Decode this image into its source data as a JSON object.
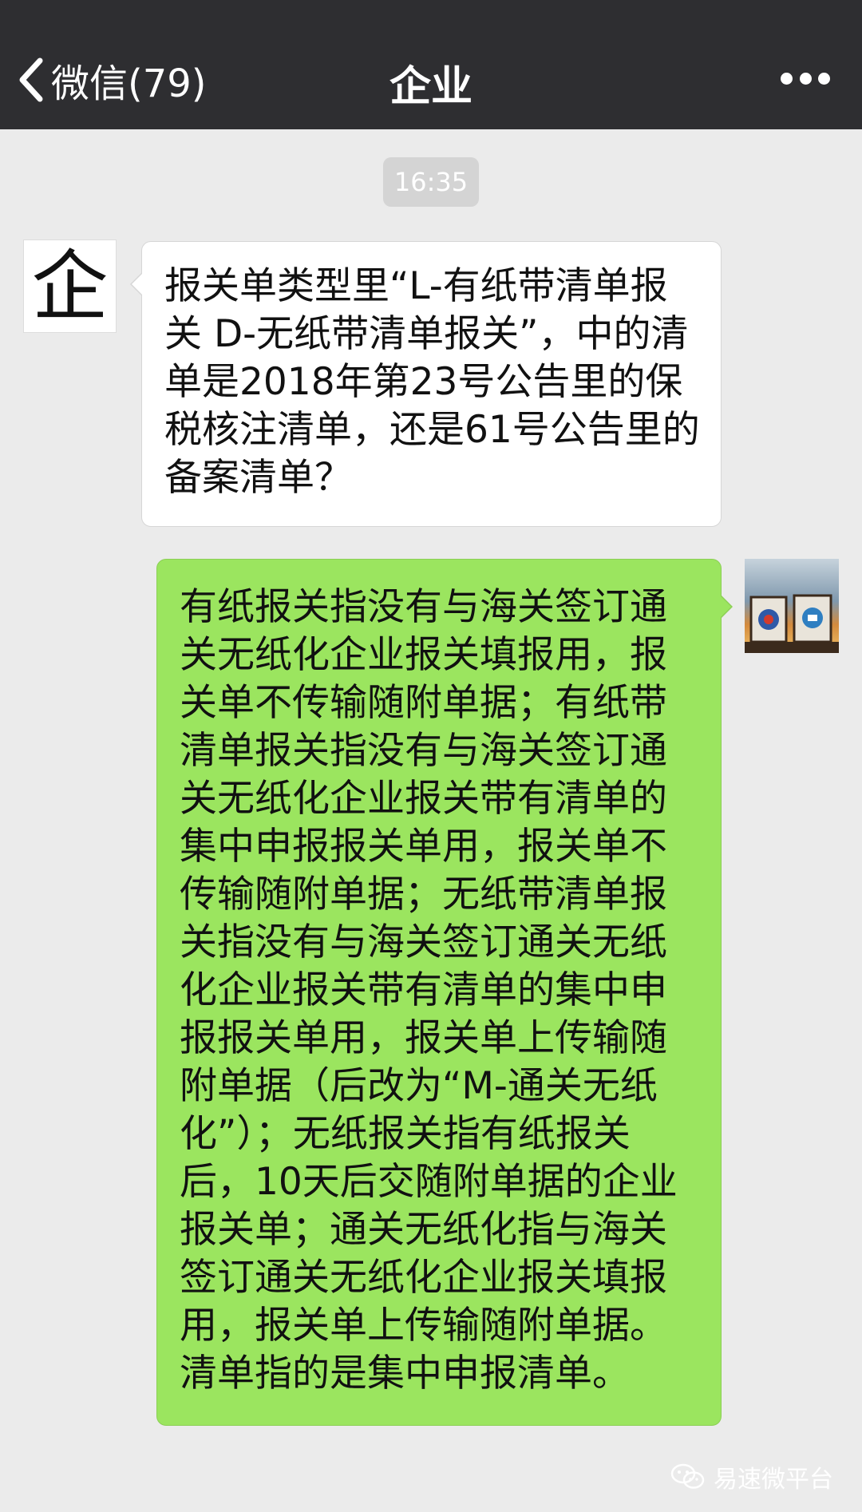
{
  "nav": {
    "back_label": "微信(79)",
    "title": "企业"
  },
  "chat": {
    "timestamp": "16:35",
    "contact_avatar_char": "企",
    "incoming_message": "报关单类型里“L-有纸带清单报关 D-无纸带清单报关”，中的清单是2018年第23号公告里的保税核注清单，还是61号公告里的备案清单？",
    "outgoing_message": "有纸报关指没有与海关签订通关无纸化企业报关填报用，报关单不传输随附单据；有纸带清单报关指没有与海关签订通关无纸化企业报关带有清单的集中申报报关单用，报关单不传输随附单据；无纸带清单报关指没有与海关签订通关无纸化企业报关带有清单的集中申报报关单用，报关单上传输随附单据（后改为“M-通关无纸化”）；无纸报关指有纸报关后，10天后交随附单据的企业报关单；通关无纸化指与海关签订通关无纸化企业报关填报用，报关单上传输随附单据。清单指的是集中申报清单。"
  },
  "watermark": {
    "text": "易速微平台"
  },
  "icons": {
    "back": "chevron-left-icon",
    "more": "more-dots-icon",
    "watermark": "wechat-logo-icon"
  },
  "colors": {
    "navbar": "#2e2e31",
    "background": "#ebebeb",
    "outgoing_bubble": "#9be55f",
    "incoming_bubble": "#ffffff",
    "timestamp_pill": "#d4d4d4"
  }
}
